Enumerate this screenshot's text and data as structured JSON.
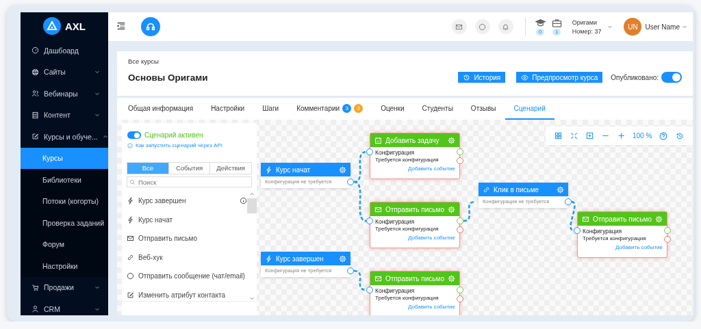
{
  "sidebar": {
    "logo": "AXL",
    "items": [
      {
        "label": "Дашбоард",
        "kind": "dashboard",
        "selected": false
      },
      {
        "label": "Сайты",
        "kind": "globe",
        "selected": false,
        "expanded": false
      },
      {
        "label": "Вебинары",
        "kind": "people",
        "selected": false,
        "expanded": false
      },
      {
        "label": "Контент",
        "kind": "content",
        "selected": false,
        "expanded": false
      },
      {
        "label": "Курсы и обуче...",
        "kind": "edit",
        "selected": false,
        "expanded": true,
        "children": [
          {
            "label": "Курсы",
            "selected": true
          },
          {
            "label": "Библиотеки",
            "selected": false
          },
          {
            "label": "Потоки (когорты)",
            "selected": false
          },
          {
            "label": "Проверка заданий",
            "selected": false
          },
          {
            "label": "Форум",
            "selected": false
          },
          {
            "label": "Настройки",
            "selected": false
          }
        ]
      },
      {
        "label": "Продажи",
        "kind": "cart",
        "selected": false,
        "expanded": false
      },
      {
        "label": "CRM",
        "kind": "person",
        "selected": false,
        "expanded": false
      }
    ]
  },
  "topbar": {
    "counters": [
      {
        "kind": "cap",
        "value": "0"
      },
      {
        "kind": "case",
        "value": "1"
      }
    ],
    "org_name": "Оригами",
    "org_number": "Номер: 37",
    "avatar": "UN",
    "user_name": "User Name"
  },
  "course": {
    "breadcrumb": "Все курсы",
    "title": "Основы Оригами",
    "buttons": [
      {
        "label": "История",
        "kind": "history"
      },
      {
        "label": "Предпросмотр курса",
        "kind": "preview"
      }
    ],
    "published_label": "Опубликовано:",
    "published": true
  },
  "tabs": [
    {
      "label": "Общая информация",
      "selected": false
    },
    {
      "label": "Настройки",
      "selected": false
    },
    {
      "label": "Шаги",
      "selected": false
    },
    {
      "label": "Комментарии",
      "selected": false,
      "badges": [
        {
          "text": "3",
          "color": "#1890ff"
        },
        {
          "text": "2",
          "color": "#f5a623"
        }
      ]
    },
    {
      "label": "Оценки",
      "selected": false
    },
    {
      "label": "Студенты",
      "selected": false
    },
    {
      "label": "Отзывы",
      "selected": false
    },
    {
      "label": "Сценарий",
      "selected": true
    }
  ],
  "scenario": {
    "active_label": "Сценарий активен",
    "active": true,
    "api_link": "Как запустить сценарий через API",
    "filters": [
      {
        "label": "Все",
        "selected": true
      },
      {
        "label": "События",
        "selected": false
      },
      {
        "label": "Действия",
        "selected": false
      }
    ],
    "search": {
      "placeholder": "Поиск"
    },
    "palette": [
      {
        "label": "Курс завершен",
        "kind": "trigger",
        "info": true
      },
      {
        "label": "Курс начат",
        "kind": "trigger",
        "info": false
      },
      {
        "label": "Отправить письмо",
        "kind": "mail",
        "info": false
      },
      {
        "label": "Веб-хук",
        "kind": "webhook",
        "info": false
      },
      {
        "label": "Отправить сообщение (чат/email)",
        "kind": "message",
        "info": false
      },
      {
        "label": "Изменить атрибут контакта",
        "kind": "attribute",
        "info": false
      }
    ],
    "zoom": "100 %",
    "nodes": [
      {
        "kind": "trigger",
        "title": "Курс начат",
        "note": "Конфигурация не требуется"
      },
      {
        "kind": "task",
        "title": "Добавить задачу",
        "config": "Конфигурация",
        "status": "Требуется конфигурация",
        "link": "Добавить событие",
        "error": true
      },
      {
        "kind": "mail",
        "title": "Отправить письмо",
        "config": "Конфигурация",
        "status": "Требуется конфигурация",
        "link": "Добавить событие",
        "error": true
      },
      {
        "kind": "click",
        "title": "Клик в письме",
        "note": "Конфигурация не требуется"
      },
      {
        "kind": "mail",
        "title": "Отправить письмо",
        "config": "Конфигурация",
        "status": "Требуется конфигурация",
        "link": "Добавить событие",
        "error": true
      },
      {
        "kind": "trigger",
        "title": "Курс завершен",
        "note": "Конфигурация не требуется"
      },
      {
        "kind": "mail",
        "title": "Отправить письмо",
        "config": "Конфигурация",
        "status": "Требуется конфигурация",
        "link": "Добавить событие",
        "error": true
      }
    ]
  }
}
